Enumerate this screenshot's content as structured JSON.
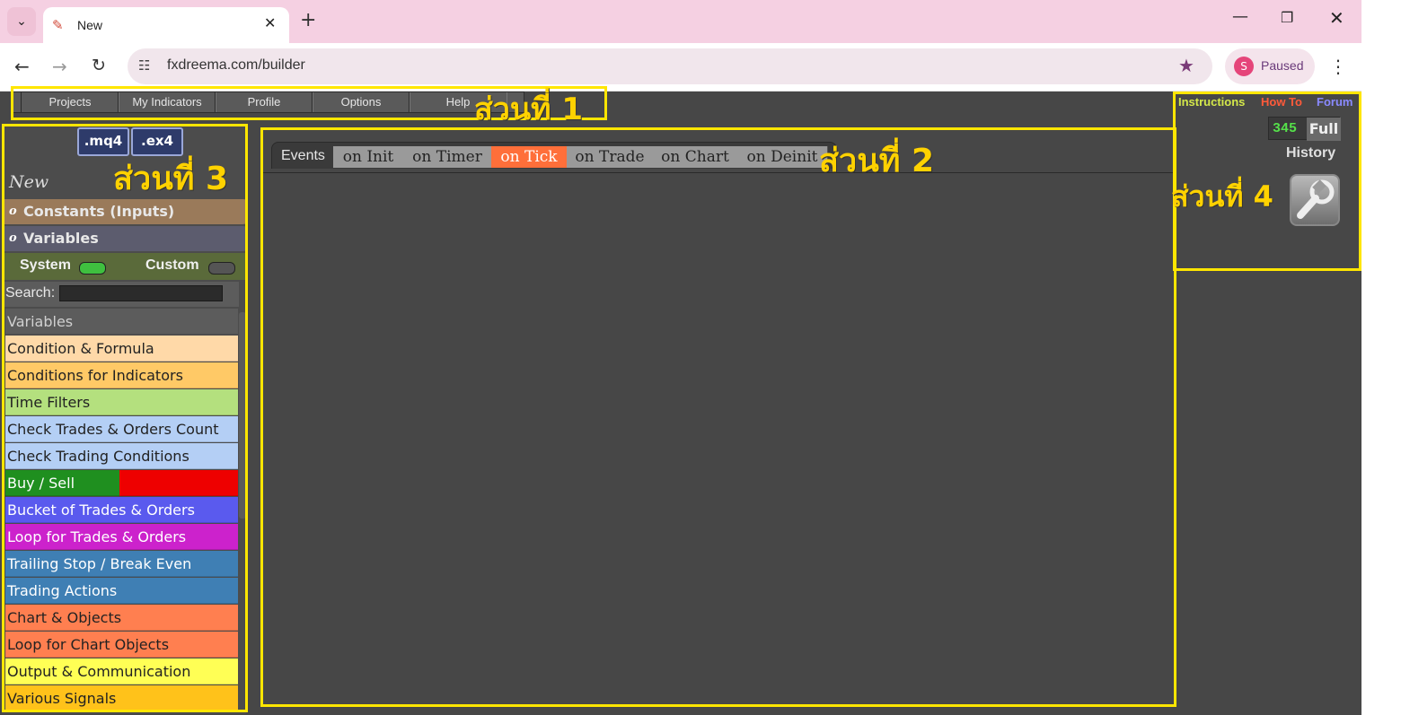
{
  "browser": {
    "tab_title": "New",
    "url": "fxdreema.com/builder",
    "profile_initial": "S",
    "profile_status": "Paused"
  },
  "menu": [
    "Projects",
    "My Indicators",
    "Profile",
    "Options",
    "Help"
  ],
  "annotations": {
    "section1": "ส่วนที่ 1",
    "section2": "ส่วนที่ 2",
    "section3": "ส่วนที่ 3",
    "section4": "ส่วนที่ 4"
  },
  "sidebar": {
    "mq4_label": ".mq4",
    "ex4_label": ".ex4",
    "new_label": "New",
    "groups": {
      "constants": "Constants (Inputs)",
      "variables": "Variables",
      "dot": "o"
    },
    "toggles": {
      "system": "System",
      "custom": "Custom"
    },
    "search_label": "Search:",
    "categories": [
      {
        "label": "Variables",
        "bg": "#5c5c5c",
        "fg": "#d0d0d0"
      },
      {
        "label": "Condition & Formula",
        "bg": "#ffd9a8",
        "fg": "#222222"
      },
      {
        "label": "Conditions for Indicators",
        "bg": "#ffc966",
        "fg": "#222222"
      },
      {
        "label": "Time Filters",
        "bg": "#b4e07e",
        "fg": "#222222"
      },
      {
        "label": "Check Trades & Orders Count",
        "bg": "#b4cff5",
        "fg": "#222222"
      },
      {
        "label": "Check Trading Conditions",
        "bg": "#b4cff5",
        "fg": "#222222"
      },
      {
        "label": "Buy / Sell",
        "bg": "#1f8f1f",
        "fg": "#ffffff",
        "split": "#ee0000"
      },
      {
        "label": "Bucket of Trades & Orders",
        "bg": "#5a5aee",
        "fg": "#ffffff"
      },
      {
        "label": "Loop for Trades & Orders",
        "bg": "#cc22cc",
        "fg": "#ffffff"
      },
      {
        "label": "Trailing Stop / Break Even",
        "bg": "#3f7fb4",
        "fg": "#ffffff"
      },
      {
        "label": "Trading Actions",
        "bg": "#3f7fb4",
        "fg": "#ffffff"
      },
      {
        "label": "Chart & Objects",
        "bg": "#ff7f50",
        "fg": "#222222"
      },
      {
        "label": "Loop for Chart Objects",
        "bg": "#ff7f50",
        "fg": "#222222"
      },
      {
        "label": "Output & Communication",
        "bg": "#ffff55",
        "fg": "#222222"
      },
      {
        "label": "Various Signals",
        "bg": "#ffc21a",
        "fg": "#222222"
      }
    ]
  },
  "events": {
    "label": "Events",
    "tabs": [
      {
        "label": "on Init",
        "active": false
      },
      {
        "label": "on Timer",
        "active": false
      },
      {
        "label": "on Tick",
        "active": true
      },
      {
        "label": "on Trade",
        "active": false
      },
      {
        "label": "on Chart",
        "active": false
      },
      {
        "label": "on Deinit",
        "active": false
      }
    ]
  },
  "right_panel": {
    "links": [
      {
        "label": "Instructions",
        "color": "#d4e84a"
      },
      {
        "label": "How To",
        "color": "#ff5a3a"
      },
      {
        "label": "Forum",
        "color": "#8a8aff"
      }
    ],
    "counter": "345",
    "full_label": "Full",
    "history_label": "History"
  },
  "colors": {
    "highlight": "#ffe600",
    "active_tab": "#ff6f3a",
    "app_bg": "#474747"
  }
}
